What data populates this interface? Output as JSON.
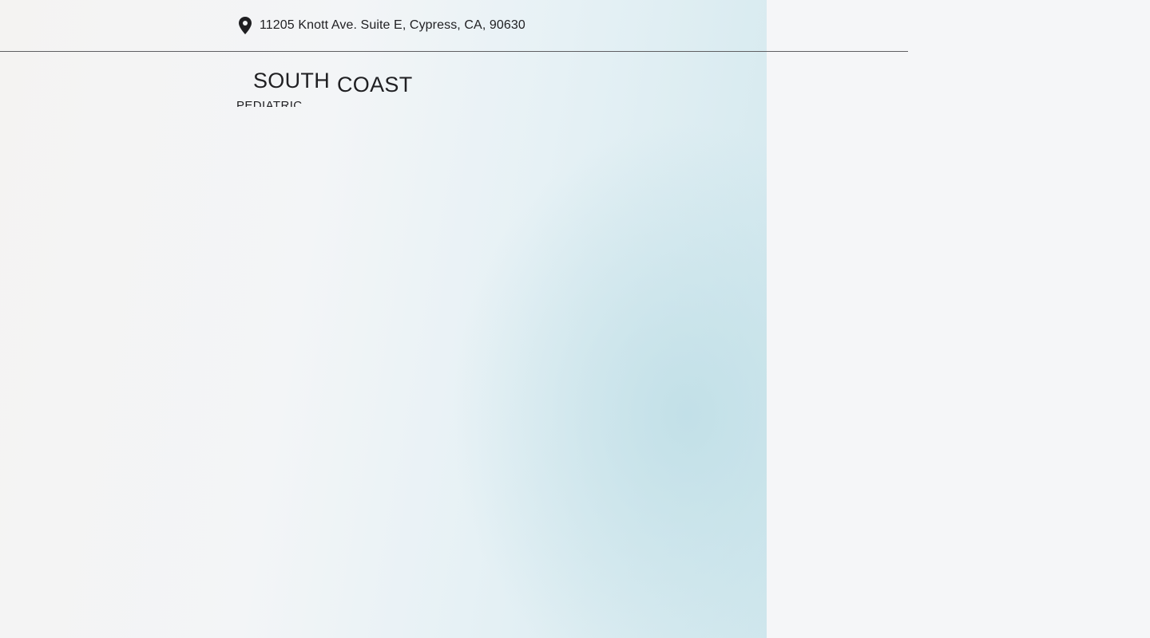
{
  "header": {
    "address": "11205 Knott Ave. Suite E, Cypress, CA, 90630",
    "address_icon": "map-pin-icon"
  },
  "logo": {
    "line1": "SOUTH",
    "line2": "COAST",
    "subline": "PEDIATRIC"
  },
  "colors": {
    "text": "#1f1f22",
    "divider": "#5f5f62",
    "hero_accent": "#d2e8ee",
    "page_background": "#f5f6f8"
  }
}
